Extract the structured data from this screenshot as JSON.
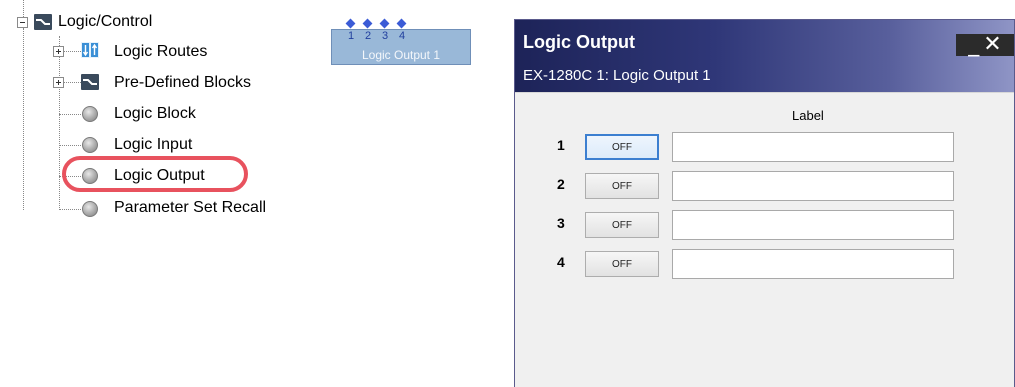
{
  "tree": {
    "root": {
      "label": "Logic/Control",
      "icon": "logic-control-icon",
      "expanded": true
    },
    "items": [
      {
        "label": "Logic Routes",
        "icon": "logic-routes-icon",
        "expandable": true
      },
      {
        "label": "Pre-Defined Blocks",
        "icon": "logic-control-icon",
        "expandable": true
      },
      {
        "label": "Logic Block",
        "icon": "gray-ball-icon",
        "expandable": false
      },
      {
        "label": "Logic Input",
        "icon": "gray-ball-icon",
        "expandable": false
      },
      {
        "label": "Logic Output",
        "icon": "gray-ball-icon",
        "expandable": false,
        "highlighted": true
      },
      {
        "label": "Parameter Set Recall",
        "icon": "gray-ball-icon",
        "expandable": false
      }
    ],
    "highlight_color": "#e8525e"
  },
  "canvas_block": {
    "label": "Logic Output 1",
    "pins": [
      "1",
      "2",
      "3",
      "4"
    ],
    "fill": "#99b8d8",
    "pin_color": "#3b5bd6"
  },
  "dialog": {
    "title": "Logic Output",
    "subtitle": "EX-1280C 1: Logic Output 1",
    "minimize_glyph": "_",
    "close_glyph": "✕",
    "column_header": "Label",
    "rows": [
      {
        "number": "1",
        "button": "OFF",
        "label_value": ""
      },
      {
        "number": "2",
        "button": "OFF",
        "label_value": ""
      },
      {
        "number": "3",
        "button": "OFF",
        "label_value": ""
      },
      {
        "number": "4",
        "button": "OFF",
        "label_value": ""
      }
    ]
  }
}
